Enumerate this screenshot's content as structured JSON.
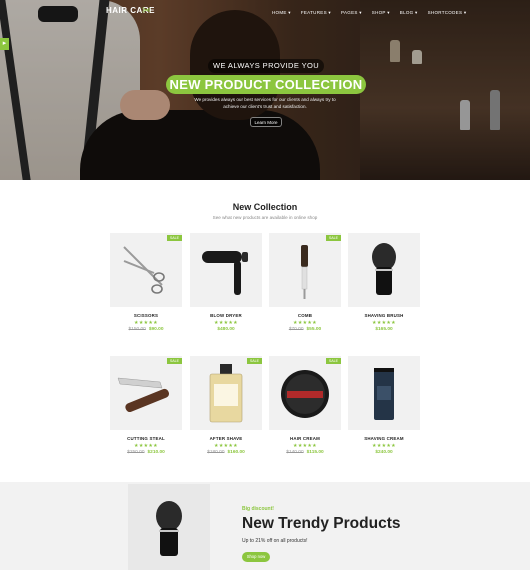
{
  "brand": {
    "logo_text": "HAIR CARE",
    "accent": "#8cc63f"
  },
  "nav": {
    "items": [
      "HOME ▾",
      "FEATURES ▾",
      "PAGES ▾",
      "SHOP ▾",
      "BLOG ▾",
      "SHORTCODES ▾"
    ]
  },
  "hero": {
    "tagline": "WE ALWAYS PROVIDE YOU",
    "headline": "NEW PRODUCT COLLECTION",
    "description": "We provides always our best services for our clients and always try to achieve our client's trust and satisfaction.",
    "button": "Learn More"
  },
  "collection": {
    "title": "New Collection",
    "subtitle": "See what new products are available in online shop",
    "products": [
      {
        "name": "SCISSORS",
        "stars": "★★★★★",
        "old": "$150.00",
        "price": "$90.00",
        "sale": "SALE"
      },
      {
        "name": "BLOW DRYER",
        "stars": "★★★★★",
        "old": "",
        "price": "$480.00",
        "sale": ""
      },
      {
        "name": "COMB",
        "stars": "★★★★★",
        "old": "$70.00",
        "price": "$55.00",
        "sale": "SALE"
      },
      {
        "name": "SHAVING BRUSH",
        "stars": "★★★★★",
        "old": "",
        "price": "$165.00",
        "sale": ""
      },
      {
        "name": "CUTTING STEAL",
        "stars": "★★★★★",
        "old": "$250.00",
        "price": "$210.00",
        "sale": "SALE"
      },
      {
        "name": "AFTER SHAVE",
        "stars": "★★★★★",
        "old": "$180.00",
        "price": "$160.00",
        "sale": "SALE"
      },
      {
        "name": "HAIR CREAM",
        "stars": "★★★★★",
        "old": "$140.00",
        "price": "$115.00",
        "sale": "SALE"
      },
      {
        "name": "SHAVING CREAM",
        "stars": "★★★★★",
        "old": "",
        "price": "$240.00",
        "sale": ""
      }
    ]
  },
  "banner": {
    "kicker": "Big discount!",
    "title": "New Trendy Products",
    "subtitle": "Up to 21% off on all products!",
    "button": "Shop now"
  }
}
